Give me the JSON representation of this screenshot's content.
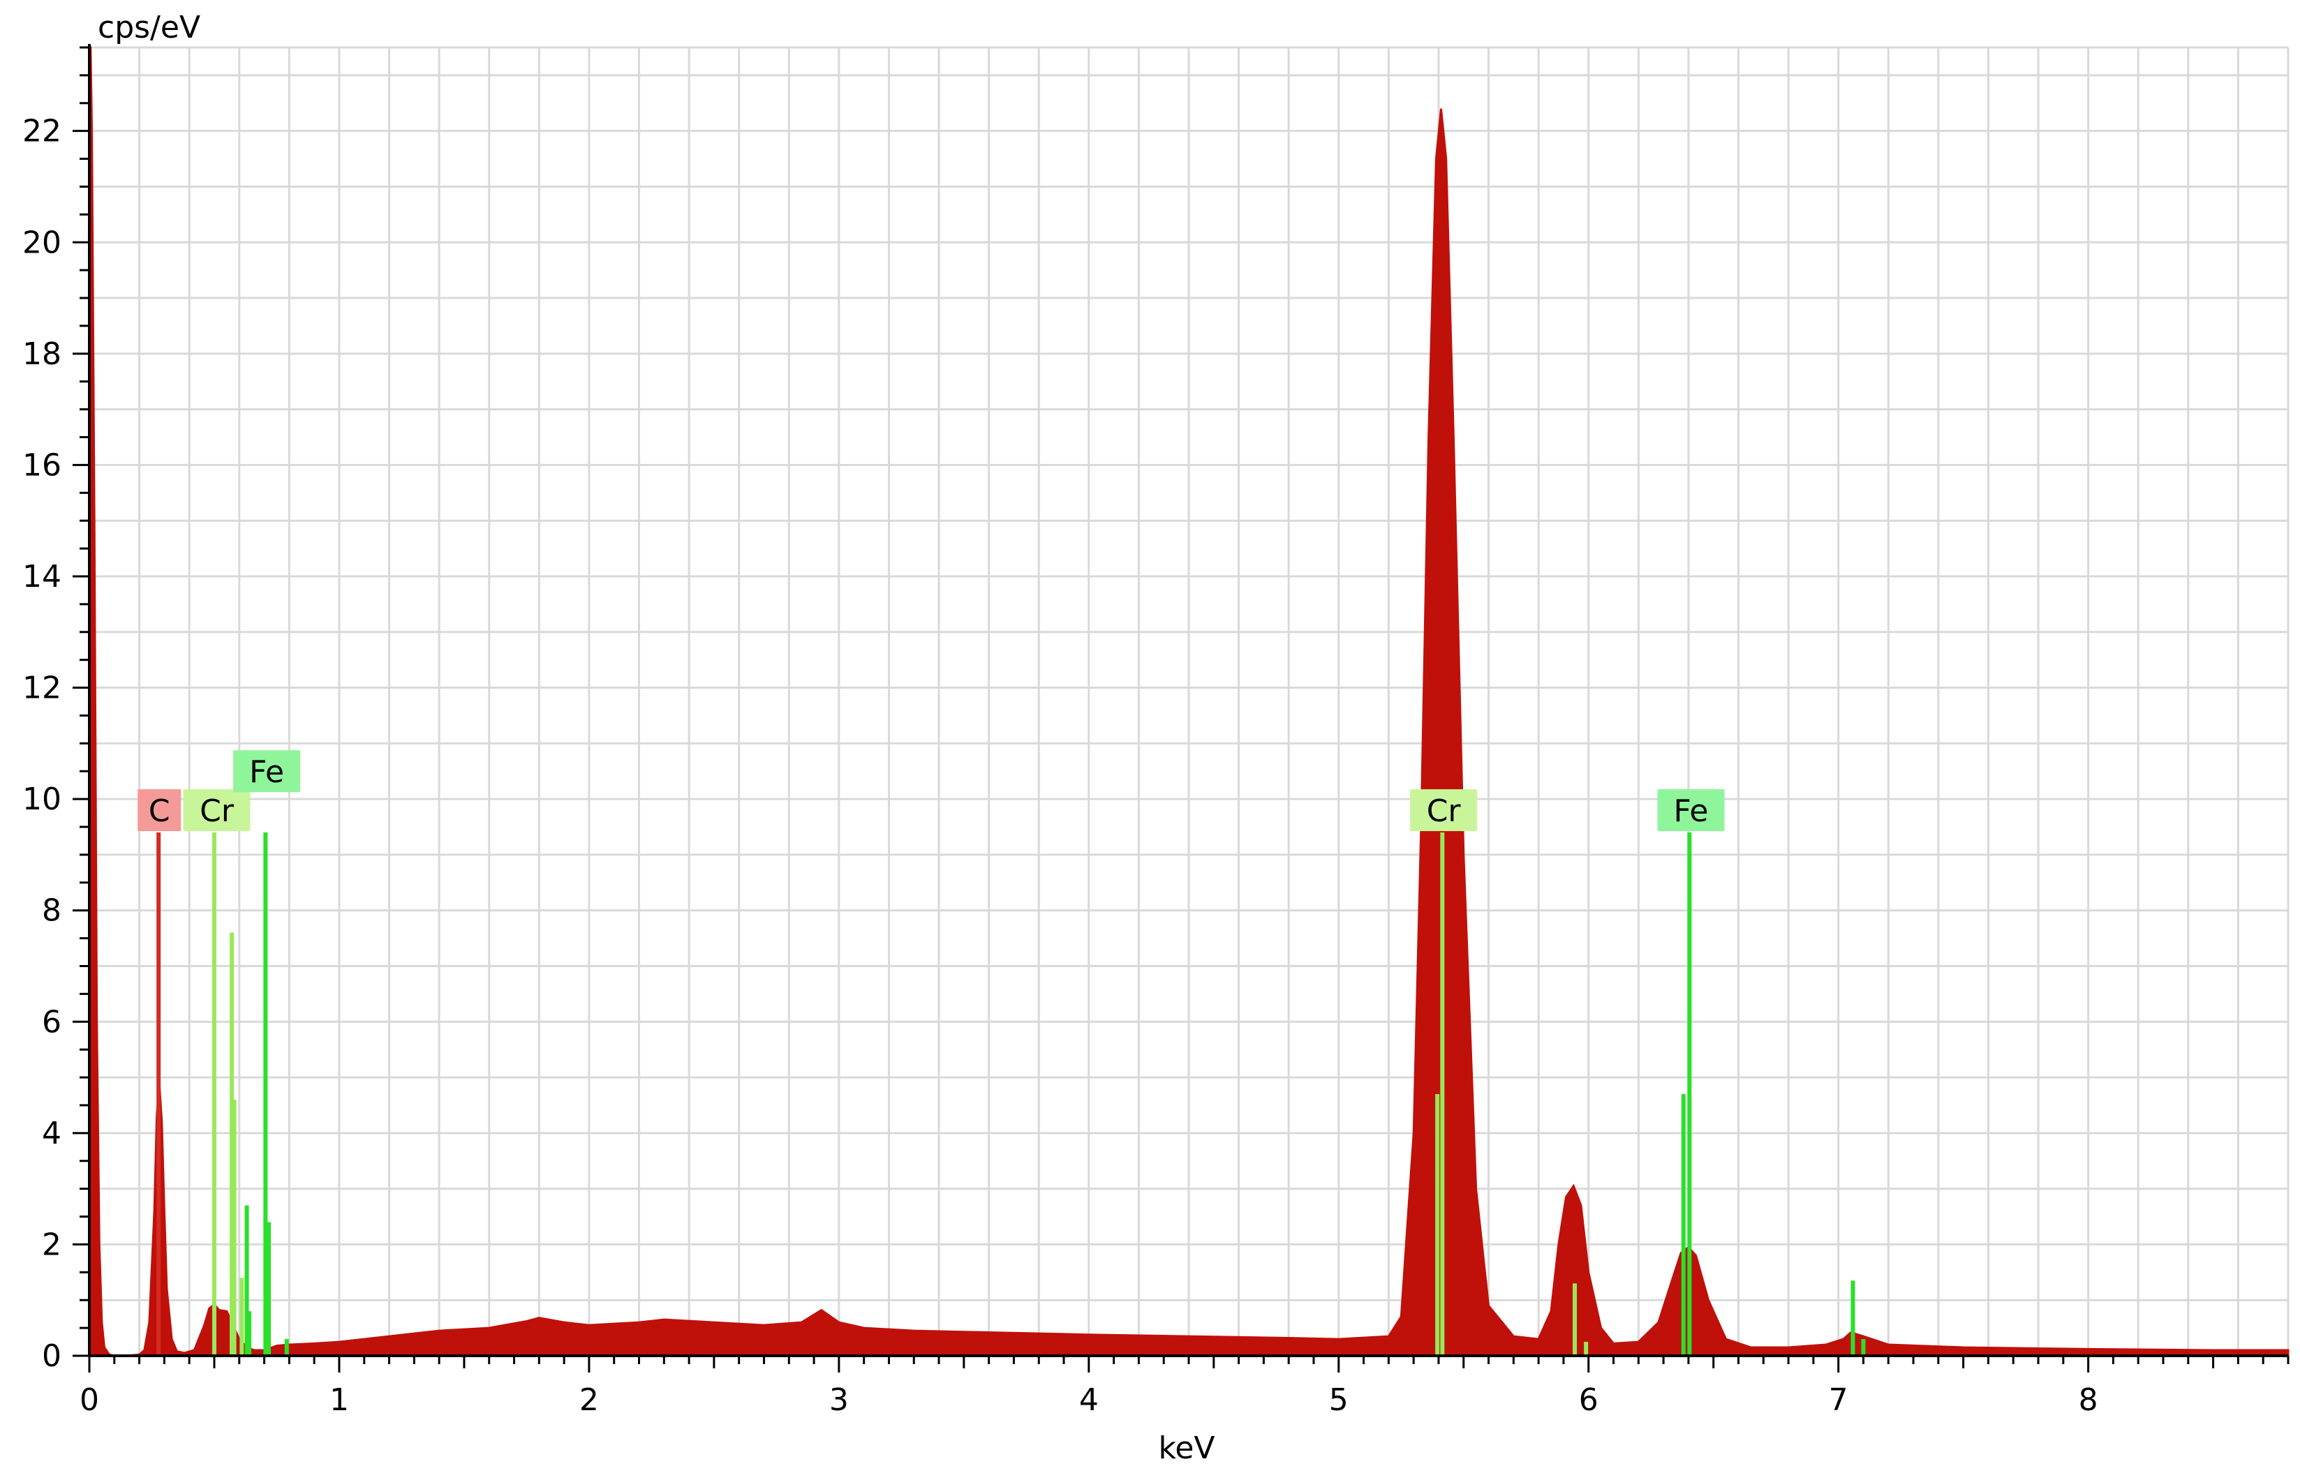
{
  "chart_data": {
    "type": "area",
    "title": "",
    "xlabel": "keV",
    "ylabel": "cps/eV",
    "xlim": [
      0,
      8.8
    ],
    "ylim": [
      0,
      23.5
    ],
    "grid": true,
    "x_ticks": [
      "0",
      "1",
      "2",
      "3",
      "4",
      "5",
      "6",
      "7",
      "8"
    ],
    "y_ticks": [
      "0",
      "2",
      "4",
      "6",
      "8",
      "10",
      "12",
      "14",
      "16",
      "18",
      "20",
      "22"
    ],
    "colors": {
      "spectrum": "#c0100a",
      "grid": "#d9d9d9",
      "C": "#f49a98",
      "Cr": "#c9f59a",
      "Fe": "#8ef59a",
      "line_C": "#d42a20",
      "line_Cr": "#9ae85a",
      "line_Fe": "#2ae02a"
    },
    "spectrum": {
      "name": "",
      "x": [
        0,
        0.005,
        0.01,
        0.02,
        0.03,
        0.04,
        0.05,
        0.06,
        0.08,
        0.1,
        0.15,
        0.2,
        0.22,
        0.24,
        0.26,
        0.27,
        0.28,
        0.29,
        0.3,
        0.31,
        0.33,
        0.35,
        0.38,
        0.42,
        0.46,
        0.48,
        0.5,
        0.52,
        0.55,
        0.58,
        0.6,
        0.63,
        0.66,
        0.7,
        0.75,
        0.8,
        0.9,
        1.0,
        1.2,
        1.4,
        1.6,
        1.75,
        1.8,
        1.9,
        2.0,
        2.2,
        2.3,
        2.5,
        2.7,
        2.85,
        2.93,
        3.0,
        3.1,
        3.3,
        3.6,
        4.0,
        4.4,
        4.8,
        5.0,
        5.2,
        5.25,
        5.3,
        5.33,
        5.36,
        5.39,
        5.41,
        5.43,
        5.46,
        5.5,
        5.55,
        5.6,
        5.7,
        5.8,
        5.85,
        5.88,
        5.91,
        5.94,
        5.97,
        6.0,
        6.05,
        6.1,
        6.2,
        6.28,
        6.33,
        6.37,
        6.4,
        6.43,
        6.48,
        6.55,
        6.65,
        6.8,
        6.95,
        7.02,
        7.05,
        7.1,
        7.2,
        7.5,
        8.0,
        8.5,
        8.8
      ],
      "y": [
        23.5,
        23.5,
        22.0,
        15.0,
        6.0,
        2.0,
        0.6,
        0.15,
        0.02,
        0.0,
        0.0,
        0.02,
        0.1,
        0.6,
        2.6,
        4.3,
        4.9,
        4.2,
        2.6,
        1.2,
        0.3,
        0.08,
        0.05,
        0.1,
        0.55,
        0.85,
        0.92,
        0.82,
        0.8,
        0.5,
        0.3,
        0.15,
        0.1,
        0.1,
        0.18,
        0.2,
        0.22,
        0.25,
        0.35,
        0.45,
        0.5,
        0.62,
        0.68,
        0.6,
        0.55,
        0.6,
        0.65,
        0.6,
        0.55,
        0.6,
        0.82,
        0.6,
        0.5,
        0.45,
        0.42,
        0.38,
        0.35,
        0.32,
        0.3,
        0.35,
        0.7,
        4.0,
        9.5,
        16.5,
        21.5,
        22.4,
        21.5,
        16.5,
        9.0,
        3.0,
        0.9,
        0.35,
        0.3,
        0.8,
        2.0,
        2.85,
        3.05,
        2.7,
        1.5,
        0.5,
        0.22,
        0.25,
        0.6,
        1.3,
        1.85,
        1.95,
        1.8,
        1.0,
        0.3,
        0.15,
        0.15,
        0.2,
        0.3,
        0.42,
        0.35,
        0.2,
        0.15,
        0.12,
        0.1,
        0.1
      ]
    },
    "element_lines": [
      {
        "element": "C",
        "color_key": "line_C",
        "lines": [
          {
            "x": 0.277,
            "y": 9.4
          }
        ]
      },
      {
        "element": "Cr",
        "color_key": "line_Cr",
        "lines": [
          {
            "x": 0.5,
            "y": 9.4
          },
          {
            "x": 0.57,
            "y": 7.6
          },
          {
            "x": 0.58,
            "y": 4.6
          },
          {
            "x": 0.61,
            "y": 1.4
          }
        ]
      },
      {
        "element": "Fe",
        "color_key": "line_Fe",
        "lines": [
          {
            "x": 0.705,
            "y": 9.4
          },
          {
            "x": 0.718,
            "y": 2.4
          },
          {
            "x": 0.63,
            "y": 2.7
          },
          {
            "x": 0.64,
            "y": 0.8
          },
          {
            "x": 0.79,
            "y": 0.3
          }
        ]
      },
      {
        "element": "Cr",
        "color_key": "line_Cr",
        "lines": [
          {
            "x": 5.395,
            "y": 4.7
          },
          {
            "x": 5.415,
            "y": 9.4
          },
          {
            "x": 5.945,
            "y": 1.3
          },
          {
            "x": 5.99,
            "y": 0.25
          }
        ]
      },
      {
        "element": "Fe",
        "color_key": "line_Fe",
        "lines": [
          {
            "x": 6.38,
            "y": 4.7
          },
          {
            "x": 6.404,
            "y": 9.4
          },
          {
            "x": 7.058,
            "y": 1.35
          },
          {
            "x": 7.1,
            "y": 0.3
          }
        ]
      }
    ],
    "labels": [
      {
        "text": "C",
        "color_key": "C",
        "x": 0.28,
        "y": 9.8
      },
      {
        "text": "Cr",
        "color_key": "Cr",
        "x": 0.51,
        "y": 9.8
      },
      {
        "text": "Fe",
        "color_key": "Fe",
        "x": 0.71,
        "y": 10.5
      },
      {
        "text": "Cr",
        "color_key": "Cr",
        "x": 5.42,
        "y": 9.8
      },
      {
        "text": "Fe",
        "color_key": "Fe",
        "x": 6.41,
        "y": 9.8
      }
    ]
  }
}
